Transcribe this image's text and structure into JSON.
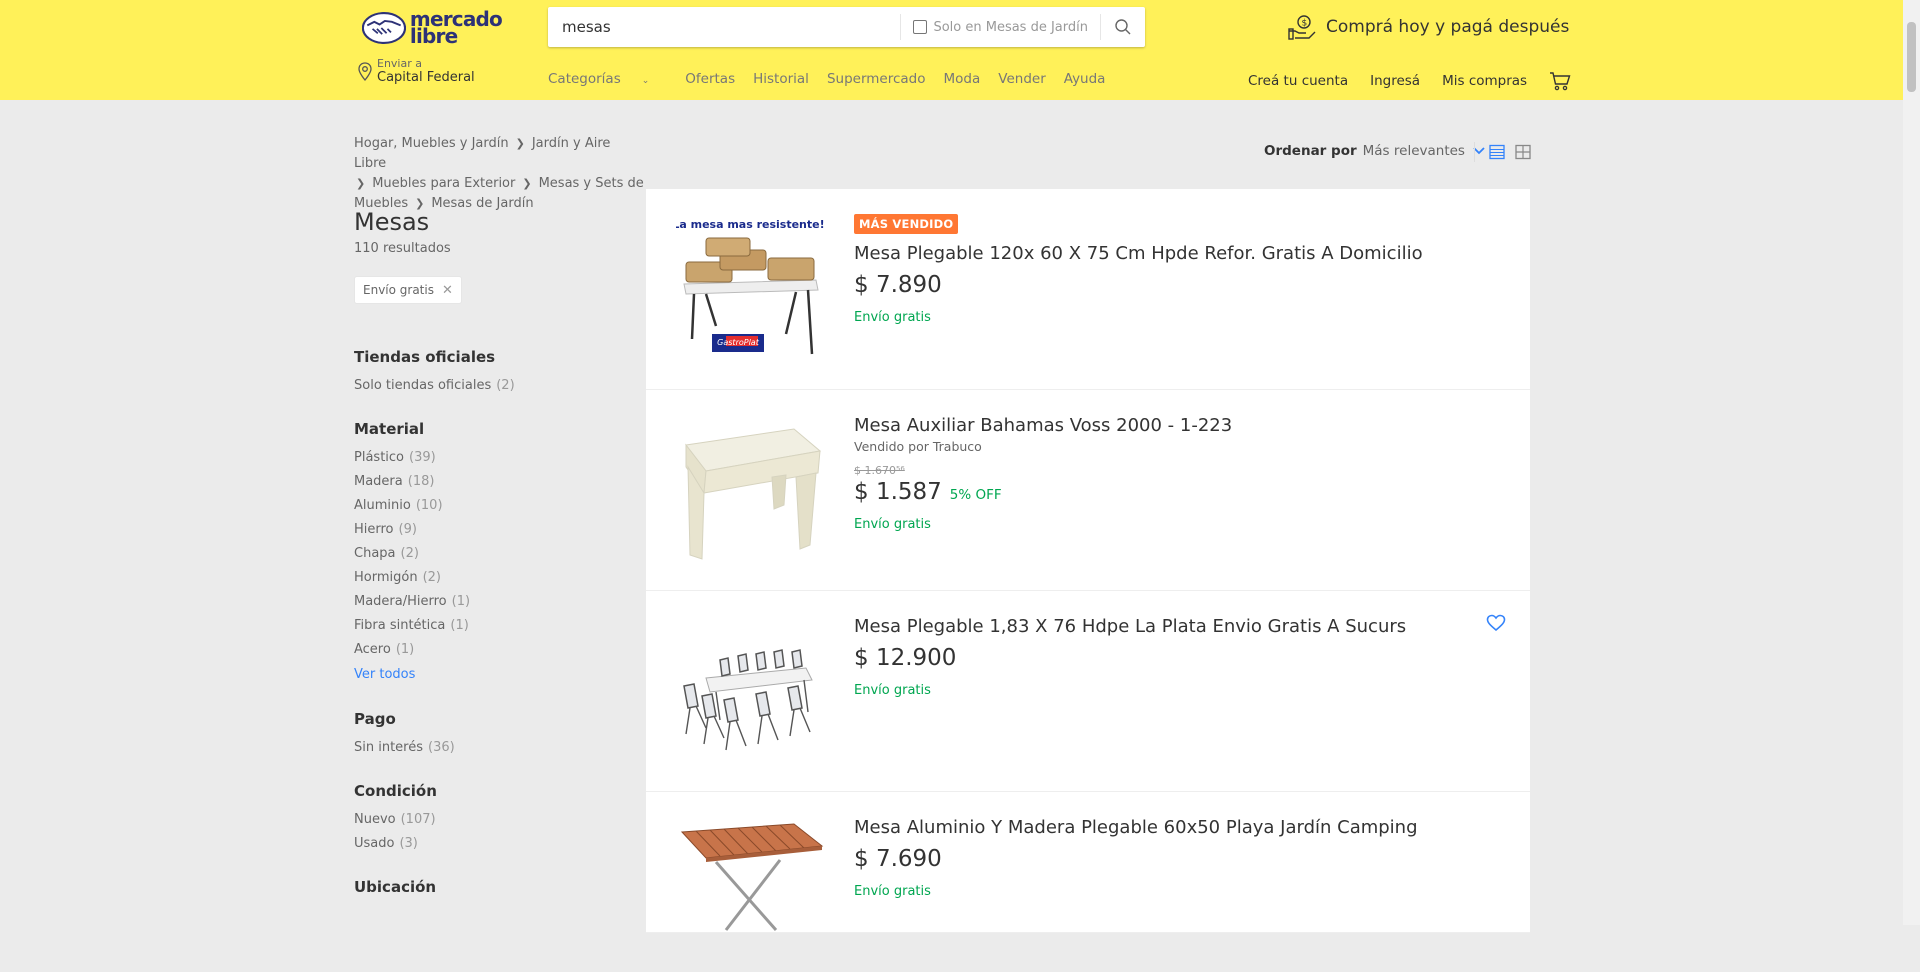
{
  "header": {
    "logo_text_line1": "mercado",
    "logo_text_line2": "libre",
    "search_value": "mesas",
    "search_checkbox_label": "Solo en Mesas de Jardín",
    "promo_text": "Comprá hoy y pagá después",
    "location_label": "Enviar a",
    "location_value": "Capital Federal",
    "nav": [
      "Categorías",
      "Ofertas",
      "Historial",
      "Supermercado",
      "Moda",
      "Vender",
      "Ayuda"
    ],
    "user_nav": [
      "Creá tu cuenta",
      "Ingresá",
      "Mis compras"
    ]
  },
  "breadcrumb": [
    "Hogar, Muebles y Jardín",
    "Jardín y Aire Libre",
    "Muebles para Exterior",
    "Mesas y Sets de Muebles",
    "Mesas de Jardín"
  ],
  "page": {
    "title": "Mesas",
    "results": "110 resultados",
    "active_filter": "Envío gratis"
  },
  "filters": [
    {
      "title": "Tiendas oficiales",
      "items": [
        {
          "label": "Solo tiendas oficiales",
          "count": "(2)"
        }
      ]
    },
    {
      "title": "Material",
      "items": [
        {
          "label": "Plástico",
          "count": "(39)"
        },
        {
          "label": "Madera",
          "count": "(18)"
        },
        {
          "label": "Aluminio",
          "count": "(10)"
        },
        {
          "label": "Hierro",
          "count": "(9)"
        },
        {
          "label": "Chapa",
          "count": "(2)"
        },
        {
          "label": "Hormigón",
          "count": "(2)"
        },
        {
          "label": "Madera/Hierro",
          "count": "(1)"
        },
        {
          "label": "Fibra sintética",
          "count": "(1)"
        },
        {
          "label": "Acero",
          "count": "(1)"
        }
      ],
      "see_all": "Ver todos"
    },
    {
      "title": "Pago",
      "items": [
        {
          "label": "Sin interés",
          "count": "(36)"
        }
      ]
    },
    {
      "title": "Condición",
      "items": [
        {
          "label": "Nuevo",
          "count": "(107)"
        },
        {
          "label": "Usado",
          "count": "(3)"
        }
      ]
    },
    {
      "title": "Ubicación",
      "items": []
    }
  ],
  "sort": {
    "label": "Ordenar por",
    "value": "Más relevantes"
  },
  "products": [
    {
      "badge": "MÁS VENDIDO",
      "title": "Mesa Plegable 120x 60 X 75 Cm Hpde Refor. Gratis A Domicilio",
      "price": "$ 7.890",
      "shipping": "Envío gratis",
      "image_caption": "La mesa mas resistente!!",
      "image_brand": "GastroPlat"
    },
    {
      "title": "Mesa Auxiliar Bahamas Voss 2000 - 1-223",
      "seller": "Vendido por Trabuco",
      "old_price": "$ 1.670⁵⁶",
      "price": "$ 1.587",
      "discount": "5% OFF",
      "shipping": "Envío gratis"
    },
    {
      "title": "Mesa Plegable 1,83 X 76 Hdpe La Plata Envio Gratis A Sucurs",
      "price": "$ 12.900",
      "shipping": "Envío gratis",
      "favorite_icon": "heart-icon"
    },
    {
      "title": "Mesa Aluminio Y Madera Plegable 60x50 Playa Jardín Camping",
      "price": "$ 7.690",
      "shipping": "Envío gratis"
    }
  ],
  "colors": {
    "header_bg": "#fff159",
    "accent_blue": "#3483fa",
    "green": "#00a650",
    "badge": "#ff7733"
  }
}
